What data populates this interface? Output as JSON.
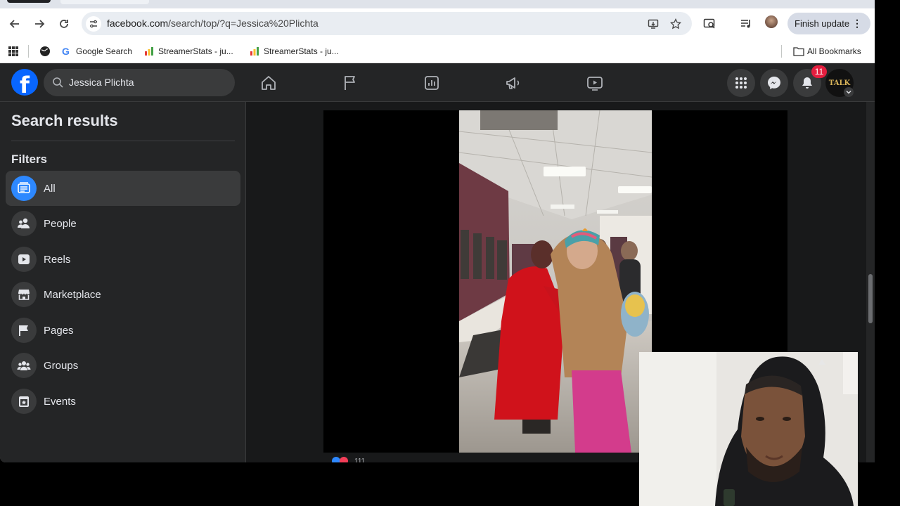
{
  "browser": {
    "url_host": "facebook.com",
    "url_path": "/search/top/?q=Jessica%20Plichta",
    "finish_update_label": "Finish update",
    "bookmarks": [
      {
        "label": "Google Search"
      },
      {
        "label": "StreamerStats - ju..."
      },
      {
        "label": "StreamerStats - ju..."
      }
    ],
    "all_bookmarks_label": "All Bookmarks"
  },
  "facebook": {
    "logo_letter": "f",
    "search_query": "Jessica Plichta",
    "notification_count": "11",
    "avatar_text": "TALK",
    "sidebar": {
      "title": "Search results",
      "filters_label": "Filters",
      "items": [
        {
          "label": "All",
          "icon": "feed-icon",
          "active": true
        },
        {
          "label": "People",
          "icon": "people-icon"
        },
        {
          "label": "Reels",
          "icon": "reels-icon"
        },
        {
          "label": "Marketplace",
          "icon": "marketplace-icon"
        },
        {
          "label": "Pages",
          "icon": "flag-icon"
        },
        {
          "label": "Groups",
          "icon": "groups-icon"
        },
        {
          "label": "Events",
          "icon": "calendar-icon"
        }
      ]
    },
    "post": {
      "reaction_count": "111"
    }
  },
  "colors": {
    "fb_blue": "#0866ff",
    "dark_bg": "#18191a",
    "surface": "#242526",
    "badge_red": "#e41e3f"
  }
}
